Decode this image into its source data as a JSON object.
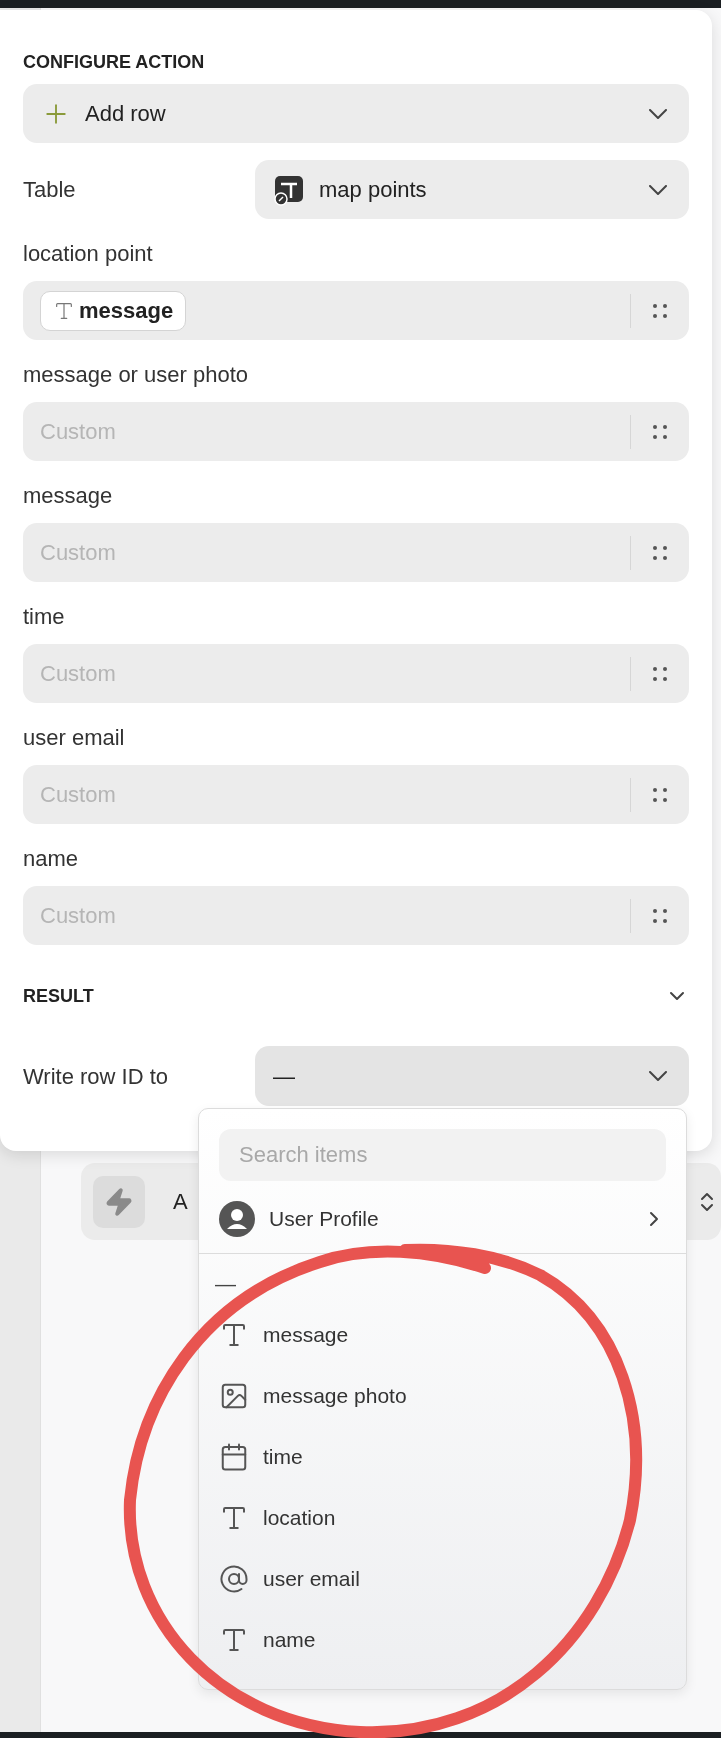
{
  "panel": {
    "title": "CONFIGURE ACTION",
    "action": {
      "label": "Add row"
    },
    "table": {
      "label": "Table",
      "value": "map points"
    },
    "fields": [
      {
        "label": "location point",
        "kind": "token",
        "value": "message"
      },
      {
        "label": "message or user photo",
        "kind": "empty",
        "placeholder": "Custom"
      },
      {
        "label": "message",
        "kind": "empty",
        "placeholder": "Custom"
      },
      {
        "label": "time",
        "kind": "empty",
        "placeholder": "Custom"
      },
      {
        "label": "user email",
        "kind": "empty",
        "placeholder": "Custom"
      },
      {
        "label": "name",
        "kind": "empty",
        "placeholder": "Custom"
      }
    ],
    "result": {
      "title": "RESULT",
      "label": "Write row ID to",
      "value": "—"
    }
  },
  "background_card": {
    "text": "A"
  },
  "dropdown": {
    "search": {
      "placeholder": "Search items"
    },
    "group": {
      "label": "User Profile"
    },
    "none_option": "—",
    "items": [
      {
        "label": "message",
        "kind": "text"
      },
      {
        "label": "message photo",
        "kind": "image"
      },
      {
        "label": "time",
        "kind": "date"
      },
      {
        "label": "location",
        "kind": "text"
      },
      {
        "label": "user email",
        "kind": "email"
      },
      {
        "label": "name",
        "kind": "text"
      }
    ]
  },
  "annotation": {
    "kind": "circle",
    "color": "#e85450"
  }
}
